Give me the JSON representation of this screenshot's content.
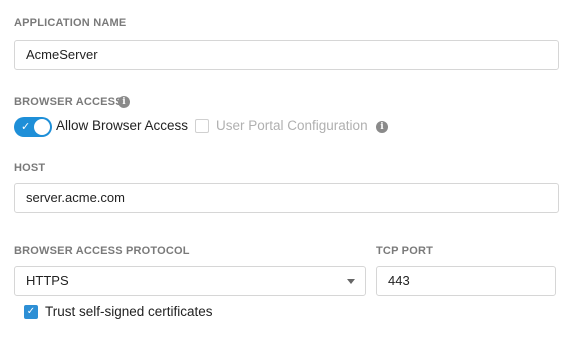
{
  "application_name": {
    "label": "APPLICATION NAME",
    "value": "AcmeServer"
  },
  "browser_access": {
    "label": "BROWSER ACCESS",
    "info_icon": "info-icon",
    "allow_toggle": {
      "label": "Allow Browser Access",
      "on": true
    },
    "user_portal": {
      "label": "User Portal Configuration",
      "checked": false,
      "disabled": true
    }
  },
  "host": {
    "label": "HOST",
    "value": "server.acme.com"
  },
  "protocol": {
    "label": "BROWSER ACCESS PROTOCOL",
    "selected": "HTTPS"
  },
  "tcp_port": {
    "label": "TCP PORT",
    "value": "443"
  },
  "trust_certs": {
    "label": "Trust self-signed certificates",
    "checked": true
  },
  "colors": {
    "accent": "#1e8fd8",
    "label_gray": "#7a7a7a",
    "border": "#d6d6d6",
    "disabled_text": "#b0b0b0"
  }
}
